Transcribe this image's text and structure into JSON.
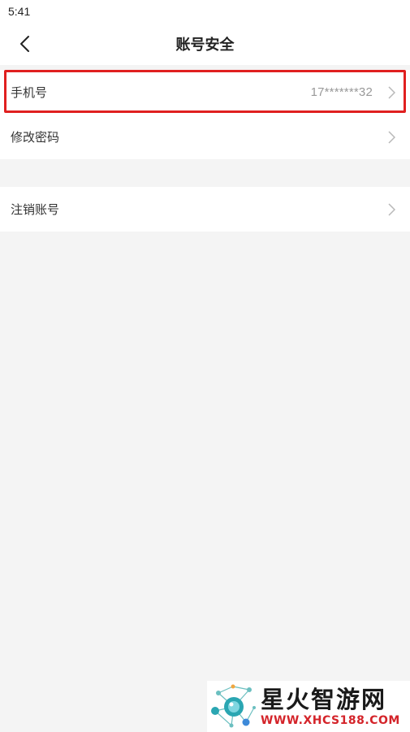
{
  "status_bar": {
    "time": "5:41"
  },
  "nav": {
    "title": "账号安全",
    "back_icon": "chevron-left-icon"
  },
  "sections": [
    {
      "items": [
        {
          "label": "手机号",
          "value": "17*******32",
          "highlighted": true
        },
        {
          "label": "修改密码",
          "value": ""
        }
      ]
    },
    {
      "items": [
        {
          "label": "注销账号",
          "value": ""
        }
      ]
    }
  ],
  "colors": {
    "background": "#f4f4f4",
    "highlight_border": "#e02020",
    "secondary_text": "#999999",
    "chevron": "#b8b8b8"
  },
  "watermark": {
    "name": "星火智游网",
    "url": "WWW.XHCS188.COM"
  }
}
